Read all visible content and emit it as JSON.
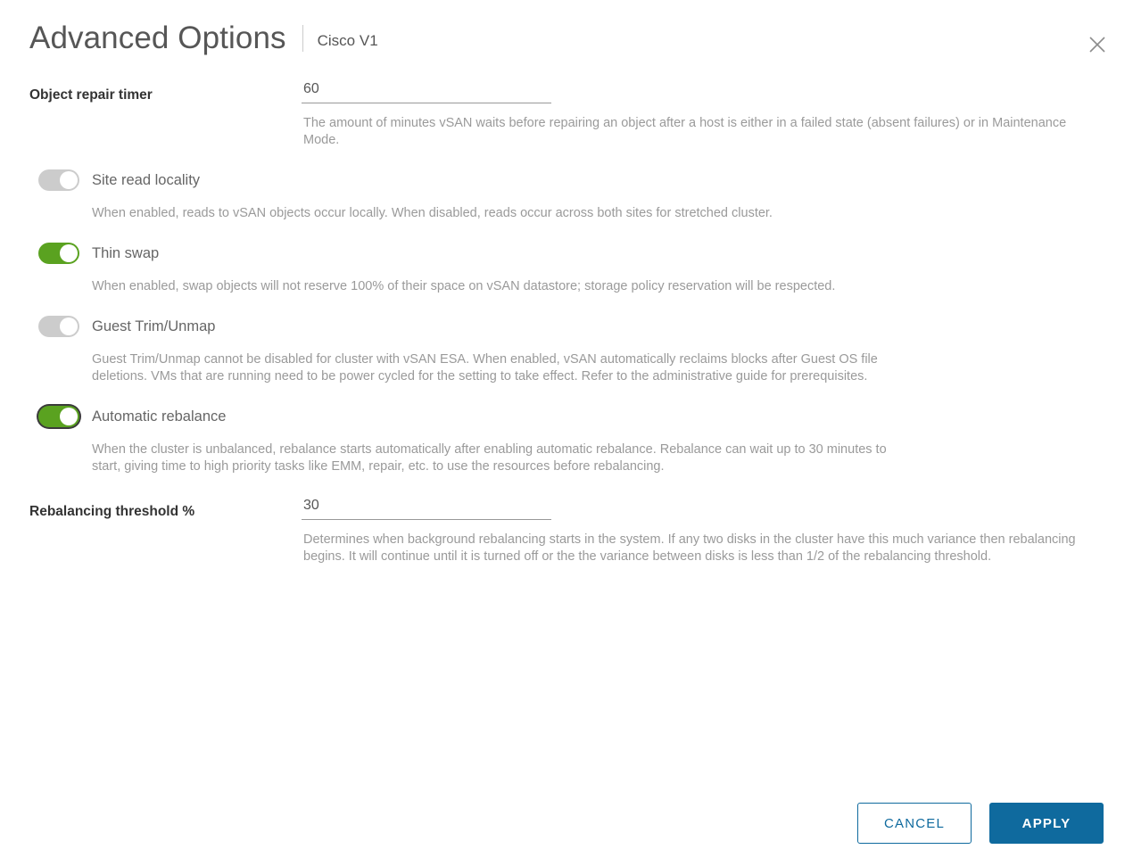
{
  "header": {
    "title": "Advanced Options",
    "subtitle": "Cisco V1",
    "close_icon": "close-icon"
  },
  "fields": {
    "object_repair_timer": {
      "label": "Object repair timer",
      "value": "60",
      "placeholder": "",
      "help": "The amount of minutes vSAN waits before repairing an object after a host is either in a failed state (absent failures) or in Maintenance Mode."
    },
    "rebalancing_threshold": {
      "label": "Rebalancing threshold %",
      "value": "30",
      "placeholder": "",
      "help": "Determines when background rebalancing starts in the system. If any two disks in the cluster have this much variance then rebalancing begins. It will continue until it is turned off or the the variance between disks is less than 1/2 of the rebalancing threshold."
    }
  },
  "toggles": [
    {
      "label": "Site read locality",
      "state": "off",
      "focused": false,
      "help": "When enabled, reads to vSAN objects occur locally. When disabled, reads occur across both sites for stretched cluster."
    },
    {
      "label": "Thin swap",
      "state": "on",
      "focused": false,
      "help": "When enabled, swap objects will not reserve 100% of their space on vSAN datastore; storage policy reservation will be respected."
    },
    {
      "label": "Guest Trim/Unmap",
      "state": "off",
      "focused": false,
      "help": "Guest Trim/Unmap cannot be disabled for cluster with vSAN ESA. When enabled, vSAN automatically reclaims blocks after Guest OS file deletions. VMs that are running need to be power cycled for the setting to take effect. Refer to the administrative guide for prerequisites."
    },
    {
      "label": "Automatic rebalance",
      "state": "on",
      "focused": true,
      "help": "When the cluster is unbalanced, rebalance starts automatically after enabling automatic rebalance. Rebalance can wait up to 30 minutes to start, giving time to high priority tasks like EMM, repair, etc. to use the resources before rebalancing."
    }
  ],
  "footer": {
    "cancel_label": "CANCEL",
    "apply_label": "APPLY"
  },
  "colors": {
    "accent_blue": "#0f6a9e",
    "toggle_on_green": "#5aa220",
    "toggle_off_grey": "#cccccc",
    "label_dark": "#333333",
    "help_grey": "#9a9a9a"
  }
}
